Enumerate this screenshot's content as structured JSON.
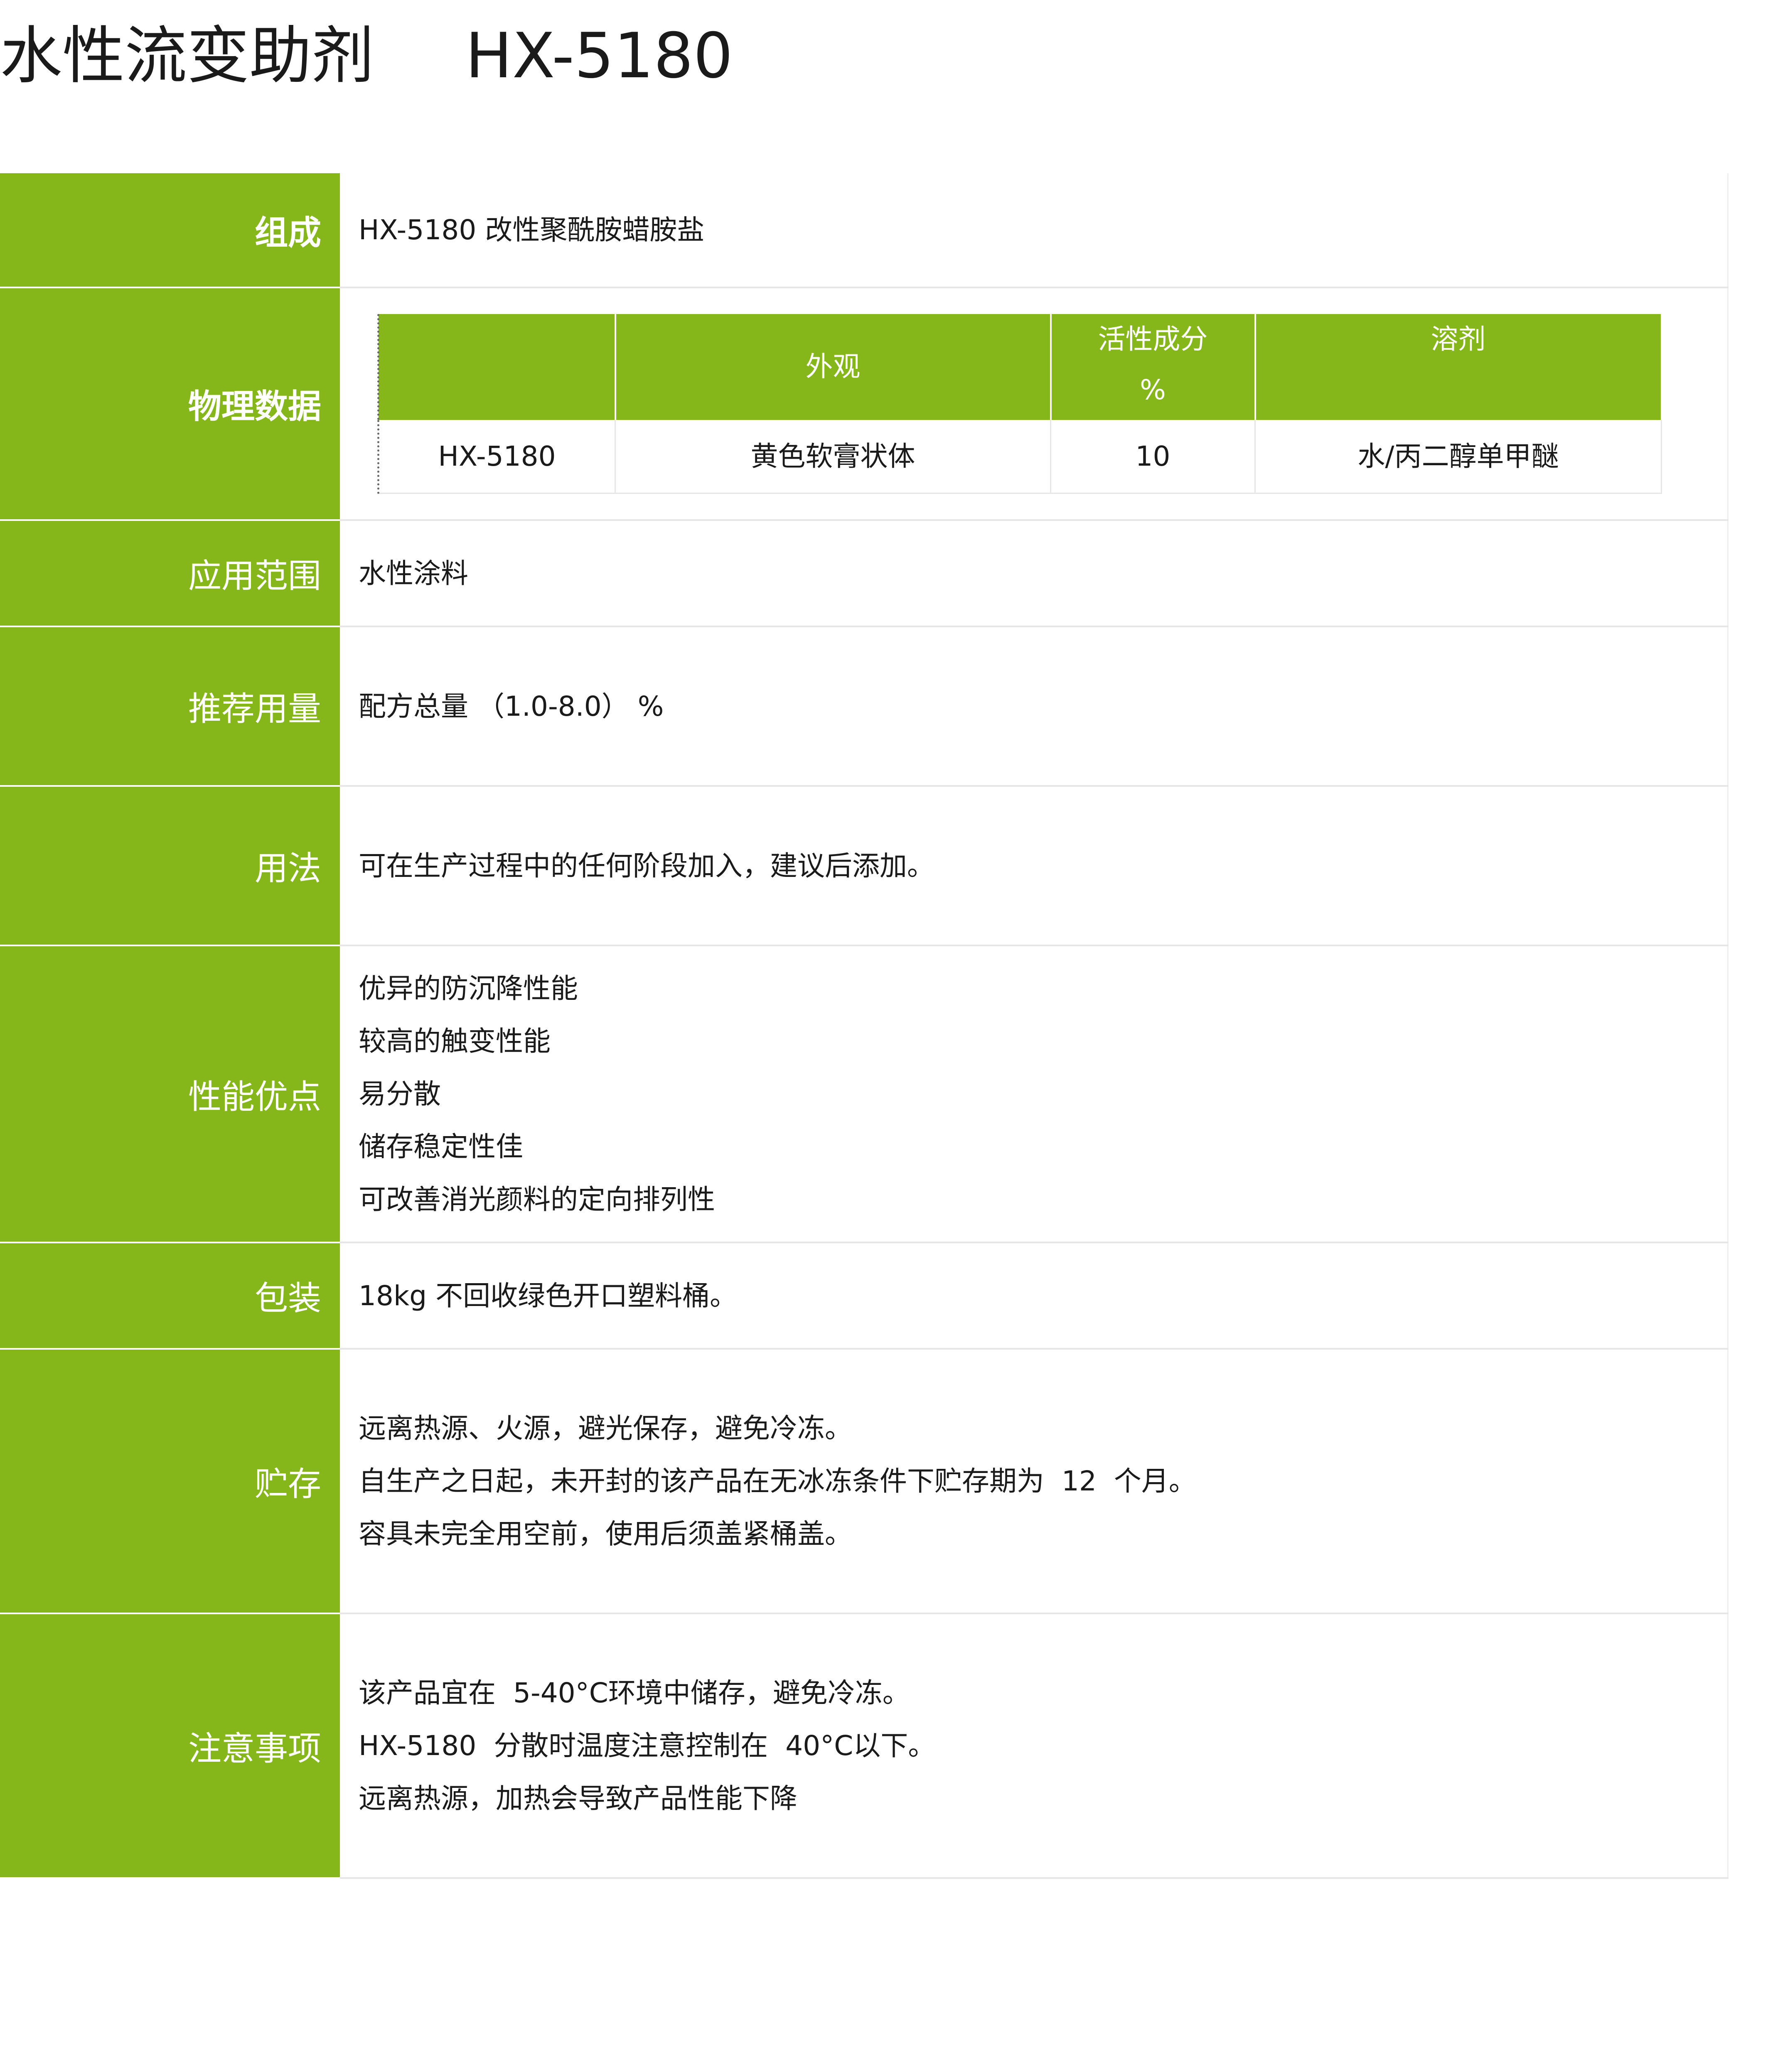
{
  "title": {
    "name": "水性流变助剂",
    "code": "HX-5180"
  },
  "rows": {
    "composition": {
      "label": "组成",
      "value": "HX-5180 改性聚酰胺蜡胺盐"
    },
    "physical": {
      "label": "物理数据",
      "headers": {
        "h0": "",
        "h1": "外观",
        "h2_line1": "活性成分",
        "h2_line2": "%",
        "h3": "溶剂"
      },
      "data": {
        "d0": "HX-5180",
        "d1": "黄色软膏状体",
        "d2": "10",
        "d3": "水/丙二醇单甲醚"
      }
    },
    "application": {
      "label": "应用范围",
      "value": "水性涂料"
    },
    "dosage": {
      "label": "推荐用量",
      "value": "配方总量  （1.0-8.0）  %"
    },
    "usage": {
      "label": "用法",
      "value": "可在生产过程中的任何阶段加入，建议后添加。"
    },
    "advantages": {
      "label": "性能优点",
      "items": [
        "优异的防沉降性能",
        "较高的触变性能",
        "易分散",
        "储存稳定性佳",
        "可改善消光颜料的定向排列性"
      ]
    },
    "packaging": {
      "label": "包装",
      "value": "18kg  不回收绿色开口塑料桶。"
    },
    "storage": {
      "label": "贮存",
      "items": [
        "远离热源、火源，避光保存，避免冷冻。",
        "自生产之日起，未开封的该产品在无冰冻条件下贮存期为  12  个月。",
        "容具未完全用空前，使用后须盖紧桶盖。"
      ]
    },
    "notes": {
      "label": "注意事项",
      "items": [
        "该产品宜在  5-40°C环境中储存，避免冷冻。",
        "HX-5180  分散时温度注意控制在  40°C以下。",
        "远离热源，加热会导致产品性能下降"
      ]
    }
  },
  "colors": {
    "label_bg": "#86b71a",
    "label_text": "#ffffff",
    "border": "#e6e6e6"
  }
}
